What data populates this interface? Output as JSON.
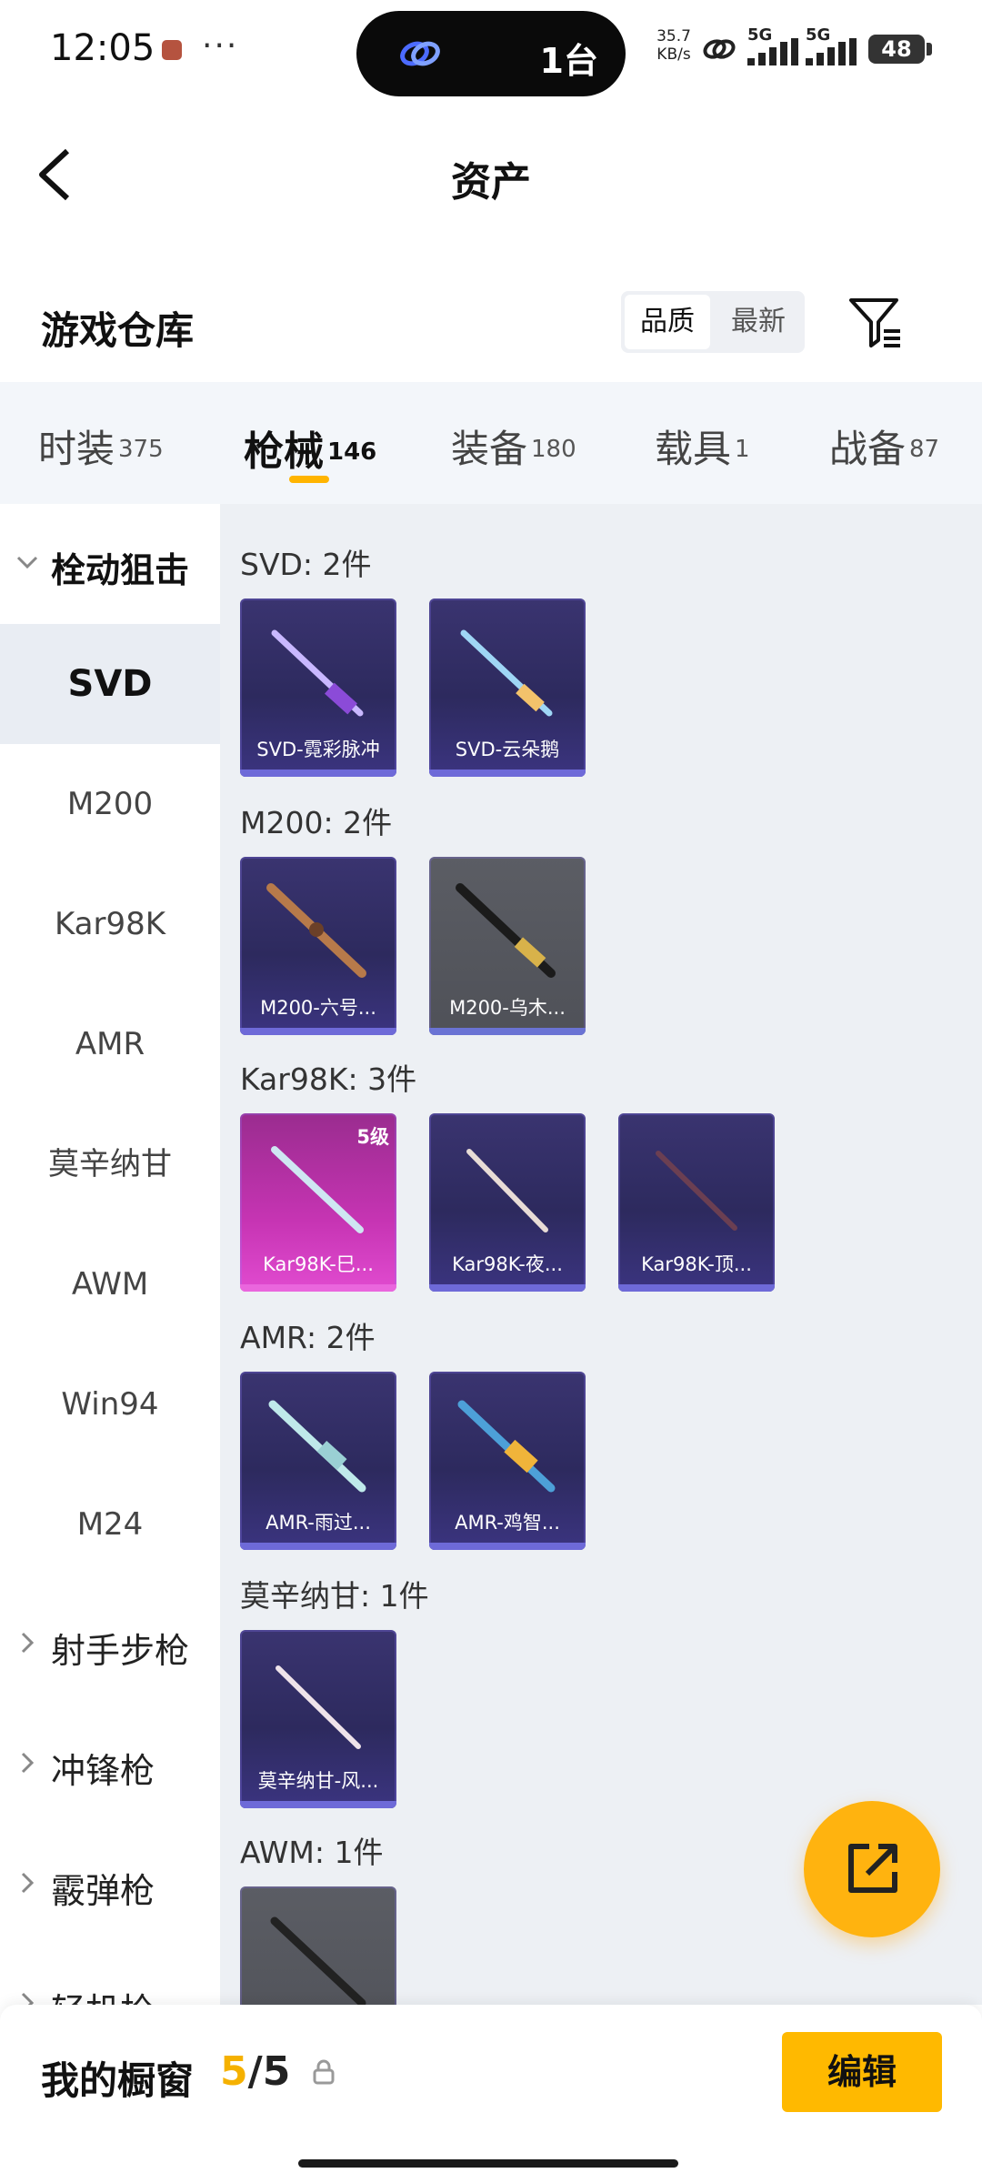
{
  "status_bar": {
    "time": "12:05",
    "more": "···",
    "island_text": "1台",
    "net_speed_value": "35.7",
    "net_speed_unit": "KB/s",
    "sim1": "5G",
    "sim2": "5G",
    "battery": "48"
  },
  "header": {
    "title": "资产"
  },
  "warehouse": {
    "title": "游戏仓库",
    "sort_active": "品质",
    "sort_inactive": "最新"
  },
  "tabs": [
    {
      "label": "时装",
      "count": "375"
    },
    {
      "label": "枪械",
      "count": "146"
    },
    {
      "label": "装备",
      "count": "180"
    },
    {
      "label": "载具",
      "count": "1"
    },
    {
      "label": "战备",
      "count": "87"
    }
  ],
  "sidebar": {
    "group_open": "栓动狙击",
    "items": [
      "SVD",
      "M200",
      "Kar98K",
      "AMR",
      "莫辛纳甘",
      "AWM",
      "Win94",
      "M24"
    ],
    "groups_closed": [
      "射手步枪",
      "冲锋枪",
      "霰弹枪",
      "轻机枪"
    ]
  },
  "sections": [
    {
      "title": "SVD: 2件",
      "cards": [
        {
          "name": "SVD-霓彩脉冲"
        },
        {
          "name": "SVD-云朵鹅"
        }
      ]
    },
    {
      "title": "M200: 2件",
      "cards": [
        {
          "name": "M200-六号..."
        },
        {
          "name": "M200-乌木..."
        }
      ]
    },
    {
      "title": "Kar98K: 3件",
      "cards": [
        {
          "name": "Kar98K-巳...",
          "level": "5级"
        },
        {
          "name": "Kar98K-夜..."
        },
        {
          "name": "Kar98K-顶..."
        }
      ]
    },
    {
      "title": "AMR: 2件",
      "cards": [
        {
          "name": "AMR-雨过..."
        },
        {
          "name": "AMR-鸡智..."
        }
      ]
    },
    {
      "title": "莫辛纳甘: 1件",
      "cards": [
        {
          "name": "莫辛纳甘-风..."
        }
      ]
    },
    {
      "title": "AWM: 1件",
      "cards": []
    }
  ],
  "bottom_bar": {
    "showcase_label": "我的橱窗",
    "showcase_current": "5",
    "showcase_total": "/5",
    "edit_label": "编辑"
  },
  "icons": {
    "back": "chevron-left-icon",
    "filter": "filter-icon",
    "share": "external-link-icon",
    "lock": "lock-icon"
  },
  "colors": {
    "accent": "#ffb900",
    "card_purple": "#2d2a5e",
    "card_grey": "#4f5158",
    "card_pink": "#c634b3"
  }
}
